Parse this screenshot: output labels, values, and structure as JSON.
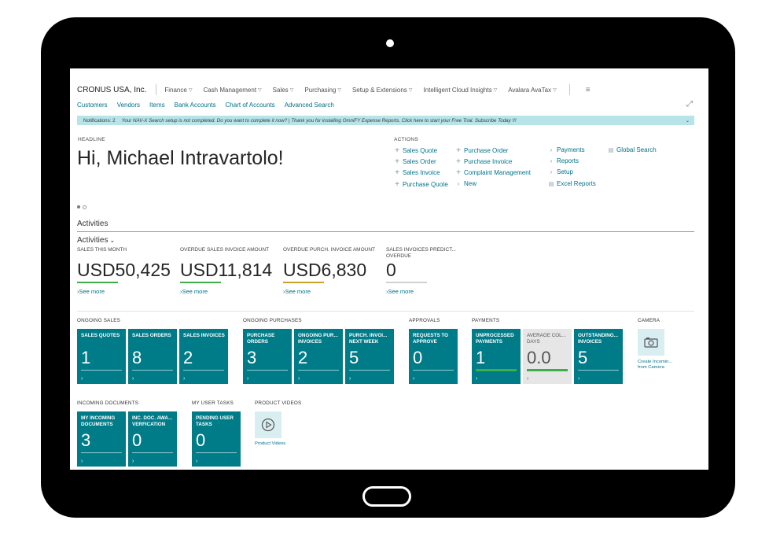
{
  "app": {
    "company": "CRONUS USA, Inc.",
    "menus": [
      "Finance",
      "Cash Management",
      "Sales",
      "Purchasing",
      "Setup & Extensions",
      "Intelligent Cloud Insights",
      "Avalara AvaTax"
    ],
    "links": [
      "Customers",
      "Vendors",
      "Items",
      "Bank Accounts",
      "Chart of Accounts",
      "Advanced Search"
    ]
  },
  "notification": {
    "count": "Notifications: 2",
    "text": "Your NAV-X Search setup is not completed. Do you want to complete it now? | Thank you for installing OmniFY Expense Reports. Click here to start your Free Trial. Subscribe Today !!!"
  },
  "headline": {
    "label": "HEADLINE",
    "greeting": "Hi, Michael Intravartolo!"
  },
  "actions": {
    "label": "ACTIONS",
    "col1": [
      "Sales Quote",
      "Sales Order",
      "Sales Invoice",
      "Purchase Quote"
    ],
    "col2": [
      "Purchase Order",
      "Purchase Invoice",
      "Complaint Management",
      "New"
    ],
    "col3": [
      "Payments",
      "Reports",
      "Setup",
      "Excel Reports"
    ],
    "col4": [
      "Global Search"
    ]
  },
  "activities": {
    "title": "Activities",
    "subtitle": "Activities",
    "see_more": "See more",
    "kpis": [
      {
        "label": "SALES THIS MONTH",
        "value": "USD50,425",
        "bar": "#3fae49"
      },
      {
        "label": "OVERDUE SALES INVOICE AMOUNT",
        "value": "USD11,814",
        "bar": "#3fae49"
      },
      {
        "label": "OVERDUE PURCH. INVOICE AMOUNT",
        "value": "USD6,830",
        "bar": "#c9a227"
      },
      {
        "label": "SALES INVOICES PREDICT... OVERDUE",
        "value": "0",
        "bar": "#d0d0d0"
      }
    ]
  },
  "groups": {
    "ongoing_sales": "ONGOING SALES",
    "ongoing_purchases": "ONGOING PURCHASES",
    "approvals": "APPROVALS",
    "payments": "PAYMENTS",
    "camera": "CAMERA",
    "incoming_documents": "INCOMING DOCUMENTS",
    "my_user_tasks": "MY USER TASKS",
    "product_videos": "PRODUCT VIDEOS"
  },
  "tiles": {
    "sales_quotes": {
      "label": "SALES QUOTES",
      "value": "1"
    },
    "sales_orders": {
      "label": "SALES ORDERS",
      "value": "8"
    },
    "sales_invoices": {
      "label": "SALES INVOICES",
      "value": "2"
    },
    "purchase_orders": {
      "label": "PURCHASE ORDERS",
      "value": "3"
    },
    "ongoing_purch_invoices": {
      "label": "ONGOING PUR... INVOICES",
      "value": "2"
    },
    "purch_invoices_next_week": {
      "label": "PURCH. INVOI... NEXT WEEK",
      "value": "5"
    },
    "requests_to_approve": {
      "label": "REQUESTS TO APPROVE",
      "value": "0"
    },
    "unprocessed_payments": {
      "label": "UNPROCESSED PAYMENTS",
      "value": "1"
    },
    "average_collection_days": {
      "label": "AVERAGE COL... DAYS",
      "value": "0.0"
    },
    "outstanding_invoices": {
      "label": "OUTSTANDING... INVOICES",
      "value": "5"
    },
    "my_incoming_documents": {
      "label": "MY INCOMING DOCUMENTS",
      "value": "3"
    },
    "inc_doc_verification": {
      "label": "INC. DOC. AWA... VERFICATION",
      "value": "0"
    },
    "pending_user_tasks": {
      "label": "PENDING USER TASKS",
      "value": "0"
    }
  },
  "camera_tile": {
    "caption_1": "Create Incomin...",
    "caption_2": "from Camera"
  },
  "video_tile": {
    "caption": "Product Videos"
  },
  "colors": {
    "tile": "#007c89",
    "link": "#00728a",
    "notif_bg": "#b6e4e8"
  }
}
